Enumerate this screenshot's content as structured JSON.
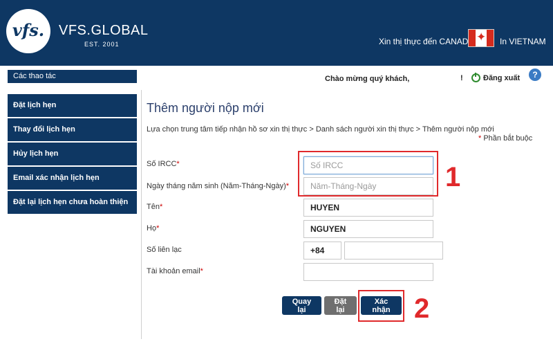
{
  "header": {
    "logo_text": "vfs.",
    "brand": "VFS.GLOBAL",
    "established": "EST. 2001",
    "visa_to": "Xin thị thực đến CANADA",
    "in_country": "In VIETNAM",
    "flag_icon": "canada-flag-icon",
    "flag_leaf": "✦",
    "colors": {
      "navy": "#0e3763",
      "red": "#e0292b"
    }
  },
  "topbar": {
    "actions_label": "Các thao tác",
    "welcome": "Chào mừng quý khách,",
    "excl": "!",
    "logout": "Đăng xuất",
    "help": "?"
  },
  "sidebar": {
    "items": [
      {
        "label": "Đặt lịch hẹn"
      },
      {
        "label": "Thay đổi lịch hẹn"
      },
      {
        "label": "Hủy lịch hẹn"
      },
      {
        "label": "Email xác nhận lịch hẹn"
      },
      {
        "label": "Đặt lại lịch hẹn chưa hoàn thiện"
      }
    ]
  },
  "main": {
    "title": "Thêm người nộp mới",
    "breadcrumb": "Lựa chọn trung tâm tiếp nhận hồ sơ xin thị thực   >  Danh sách người xin thị thực   >  Thêm người nộp mới",
    "required_star": "*",
    "required_note": " Phần bắt buộc"
  },
  "form": {
    "ircc_label": "Số IRCC",
    "ircc_placeholder": "Số IRCC",
    "dob_label": "Ngày tháng năm sinh (Năm-Tháng-Ngày)",
    "dob_placeholder": "Năm-Tháng-Ngày",
    "first_name_label": "Tên",
    "first_name_value": "HUYEN",
    "last_name_label": "Họ",
    "last_name_value": "NGUYEN",
    "phone_label": "Số liên lạc",
    "phone_code": "+84",
    "phone_value": "",
    "email_label": "Tài khoản email",
    "email_value": "",
    "star": "*"
  },
  "buttons": {
    "back": "Quay lại",
    "reset": "Đặt lại",
    "confirm": "Xác nhận"
  },
  "annotations": {
    "one": "1",
    "two": "2"
  }
}
